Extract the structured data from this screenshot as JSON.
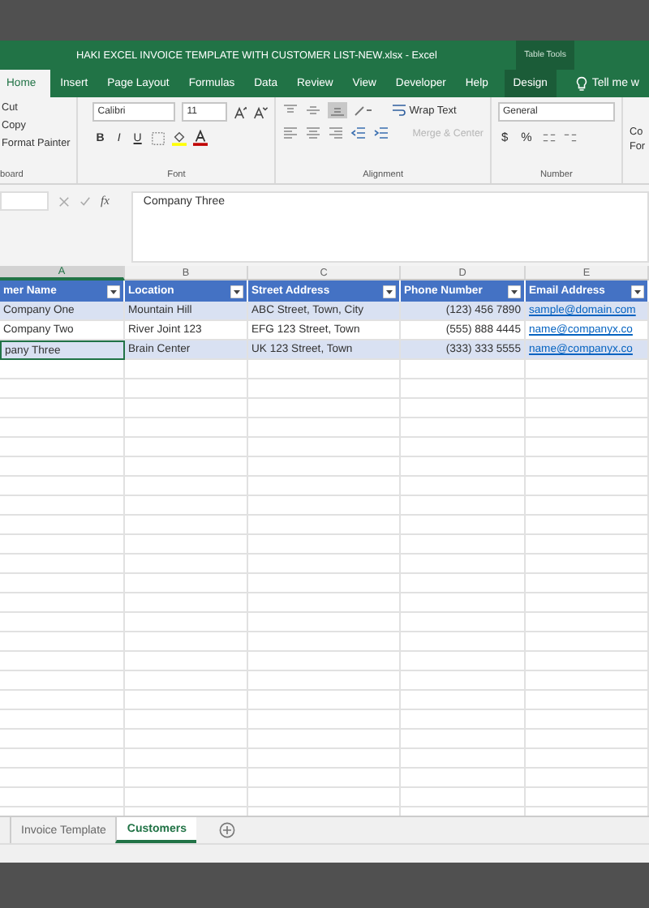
{
  "title_bar": {
    "title": "HAKI EXCEL INVOICE TEMPLATE WITH CUSTOMER LIST-NEW.xlsx  -  Excel",
    "context_label": "Table Tools"
  },
  "ribbon_tabs": [
    {
      "label": "Home",
      "selected": true,
      "kind": "tab"
    },
    {
      "label": "Insert",
      "selected": false,
      "kind": "tab"
    },
    {
      "label": "Page Layout",
      "selected": false,
      "kind": "tab"
    },
    {
      "label": "Formulas",
      "selected": false,
      "kind": "tab"
    },
    {
      "label": "Data",
      "selected": false,
      "kind": "tab"
    },
    {
      "label": "Review",
      "selected": false,
      "kind": "tab"
    },
    {
      "label": "View",
      "selected": false,
      "kind": "tab"
    },
    {
      "label": "Developer",
      "selected": false,
      "kind": "tab"
    },
    {
      "label": "Help",
      "selected": false,
      "kind": "tab"
    },
    {
      "label": "Design",
      "selected": false,
      "kind": "context"
    },
    {
      "label": "Tell me w",
      "selected": false,
      "kind": "search"
    }
  ],
  "clipboard": {
    "items": [
      "Cut",
      "Copy",
      "Format Painter"
    ],
    "group_label": "board"
  },
  "font": {
    "family": "Calibri",
    "size": "11",
    "styles": [
      "B",
      "I",
      "U"
    ],
    "group_label": "Font"
  },
  "alignment": {
    "wrap_text": "Wrap Text",
    "merge": {
      "label": "Merge & Center",
      "disabled": true
    },
    "group_label": "Alignment"
  },
  "number": {
    "format": "General",
    "symbols": [
      "$",
      "%"
    ],
    "group_label": "Number"
  },
  "styles_cut": [
    "Co",
    "For"
  ],
  "formula_bar": {
    "function_label": "fx",
    "value": "Company Three"
  },
  "sheet": {
    "columns": [
      {
        "letter": "A",
        "header": "mer Name",
        "kind": "text",
        "selected": true
      },
      {
        "letter": "B",
        "header": "Location",
        "kind": "text",
        "selected": false
      },
      {
        "letter": "C",
        "header": "Street Address",
        "kind": "text",
        "selected": false
      },
      {
        "letter": "D",
        "header": "Phone Number",
        "kind": "number",
        "selected": false
      },
      {
        "letter": "E",
        "header": "Email Address",
        "kind": "link",
        "selected": false
      }
    ],
    "rows": [
      {
        "cells": [
          {
            "text": "Company One",
            "selected": false
          },
          {
            "text": "Mountain Hill",
            "selected": false
          },
          {
            "text": "ABC Street, Town, City",
            "selected": false
          },
          {
            "text": "(123) 456 7890",
            "selected": false
          },
          {
            "text": "sample@domain.com",
            "selected": false
          }
        ]
      },
      {
        "cells": [
          {
            "text": "Company Two",
            "selected": false
          },
          {
            "text": "River Joint 123",
            "selected": false
          },
          {
            "text": "EFG 123 Street, Town",
            "selected": false
          },
          {
            "text": "(555) 888 4445",
            "selected": false
          },
          {
            "text": "name@companyx.co",
            "selected": false
          }
        ]
      },
      {
        "cells": [
          {
            "text": "pany Three",
            "selected": true
          },
          {
            "text": "Brain Center",
            "selected": false
          },
          {
            "text": "UK 123 Street, Town",
            "selected": false
          },
          {
            "text": "(333) 333 5555",
            "selected": false
          },
          {
            "text": "name@companyx.co",
            "selected": false
          }
        ]
      }
    ]
  },
  "sheet_tabs": [
    {
      "label": "Invoice Template",
      "selected": false
    },
    {
      "label": "Customers",
      "selected": true
    }
  ]
}
